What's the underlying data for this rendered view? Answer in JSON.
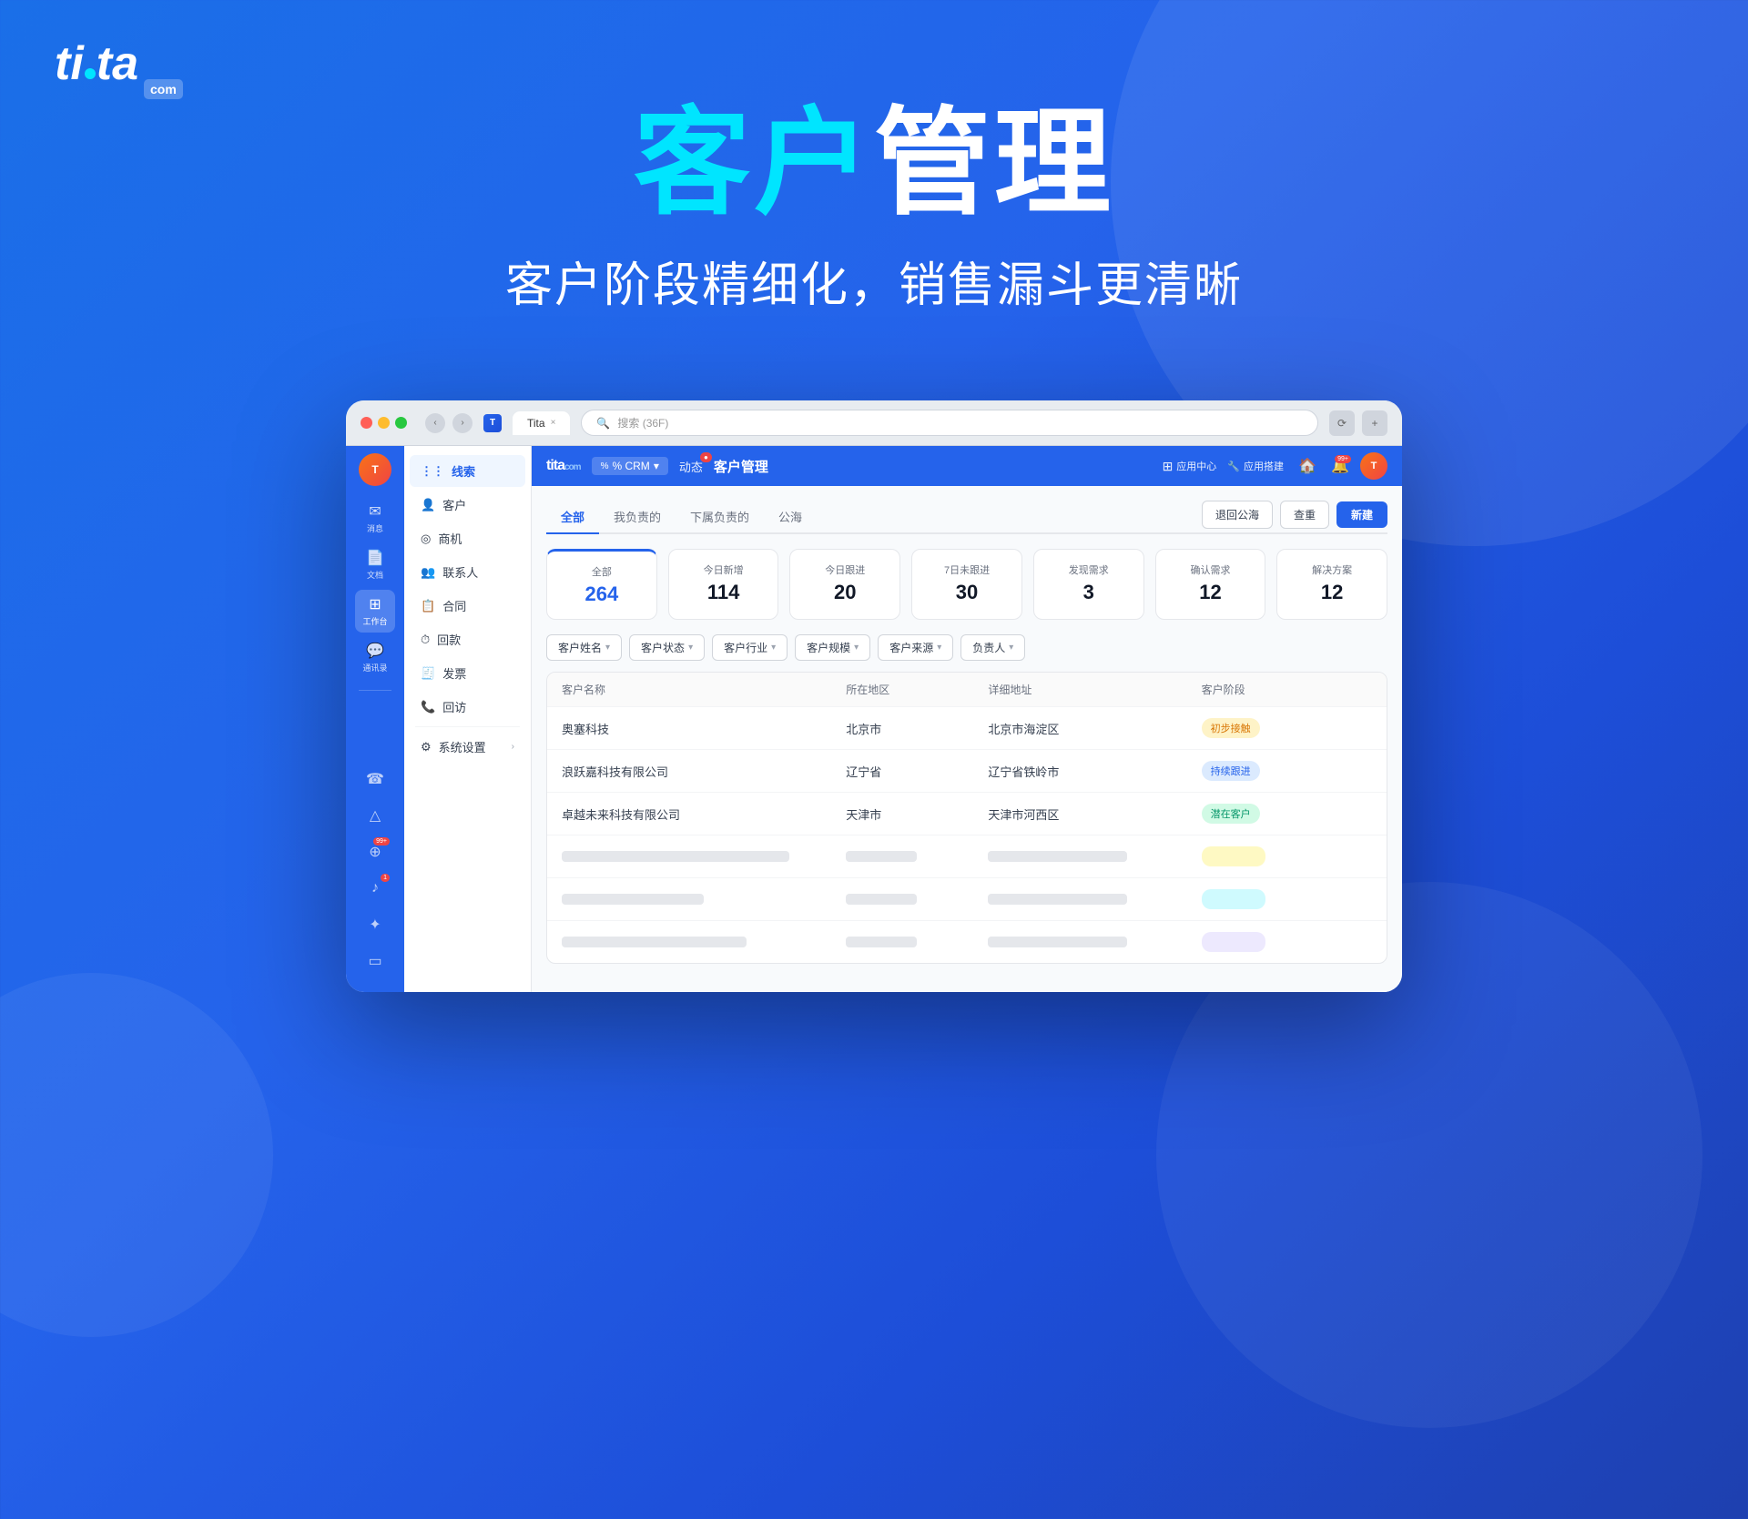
{
  "brand": {
    "name_ti": "ti",
    "name_dot": "·",
    "name_ta": "ta",
    "com_label": "com"
  },
  "page": {
    "main_title_cyan": "客户",
    "main_title_white": "管理",
    "sub_title": "客户阶段精细化，销售漏斗更清晰"
  },
  "window": {
    "tab_title": "Tita",
    "search_placeholder": "搜索 (36F)"
  },
  "topbar": {
    "logo": "tita",
    "logo_sub": "com",
    "crm_label": "% CRM",
    "dynamics_label": "动态",
    "dynamics_badge": "●",
    "page_title": "客户管理",
    "app_center": "应用中心",
    "build": "应用搭建"
  },
  "sidebar_main": {
    "items": [
      {
        "icon": "✉",
        "label": "消息"
      },
      {
        "icon": "📄",
        "label": "文档"
      },
      {
        "icon": "⊞",
        "label": "工作台",
        "active": true
      },
      {
        "icon": "💬",
        "label": "通讯录"
      }
    ],
    "bottom_items": [
      {
        "icon": "☎",
        "label": "",
        "badge": ""
      },
      {
        "icon": "△",
        "label": ""
      },
      {
        "icon": "⊕",
        "label": "",
        "badge": "99+"
      },
      {
        "icon": "♪",
        "label": "",
        "badge": "1"
      },
      {
        "icon": "✦",
        "label": ""
      },
      {
        "icon": "▭",
        "label": ""
      }
    ]
  },
  "sidebar_secondary": {
    "items": [
      {
        "icon": "⋮⋮",
        "label": "线索",
        "active": true
      },
      {
        "icon": "👤",
        "label": "客户"
      },
      {
        "icon": "◎",
        "label": "商机"
      },
      {
        "icon": "👥",
        "label": "联系人"
      },
      {
        "icon": "📋",
        "label": "合同"
      },
      {
        "icon": "⏱",
        "label": "回款"
      },
      {
        "icon": "🧾",
        "label": "发票"
      },
      {
        "icon": "📞",
        "label": "回访"
      },
      {
        "icon": "⚙",
        "label": "系统设置",
        "has_arrow": true
      }
    ]
  },
  "tabs": {
    "items": [
      {
        "label": "全部",
        "active": true
      },
      {
        "label": "我负责的"
      },
      {
        "label": "下属负责的"
      },
      {
        "label": "公海"
      }
    ],
    "btn_back": "退回公海",
    "btn_dedup": "查重",
    "btn_new": "新建"
  },
  "stats": [
    {
      "label": "全部",
      "value": "264",
      "blue": true
    },
    {
      "label": "今日新增",
      "value": "114"
    },
    {
      "label": "今日跟进",
      "value": "20"
    },
    {
      "label": "7日未跟进",
      "value": "30"
    },
    {
      "label": "发现需求",
      "value": "3"
    },
    {
      "label": "确认需求",
      "value": "12"
    },
    {
      "label": "解决方案",
      "value": "12"
    }
  ],
  "filters": [
    {
      "label": "客户姓名"
    },
    {
      "label": "客户状态"
    },
    {
      "label": "客户行业"
    },
    {
      "label": "客户规模"
    },
    {
      "label": "客户来源"
    },
    {
      "label": "负责人"
    }
  ],
  "table": {
    "headers": [
      "客户名称",
      "所在地区",
      "详细地址",
      "客户阶段"
    ],
    "rows": [
      {
        "name": "奥塞科技",
        "region": "北京市",
        "address": "北京市海淀区",
        "stage": "初步接触",
        "stage_type": "initial"
      },
      {
        "name": "浪跃嘉科技有限公司",
        "region": "辽宁省",
        "address": "辽宁省铁岭市",
        "stage": "持续跟进",
        "stage_type": "follow"
      },
      {
        "name": "卓越未来科技有限公司",
        "region": "天津市",
        "address": "天津市河西区",
        "stage": "潜在客户",
        "stage_type": "potential"
      },
      {
        "name": "",
        "region": "",
        "address": "",
        "stage": "",
        "stage_type": "yellow",
        "skeleton": true
      },
      {
        "name": "",
        "region": "",
        "address": "",
        "stage": "",
        "stage_type": "cyan",
        "skeleton": true
      },
      {
        "name": "",
        "region": "",
        "address": "",
        "stage": "",
        "stage_type": "purple",
        "skeleton": true
      }
    ]
  }
}
